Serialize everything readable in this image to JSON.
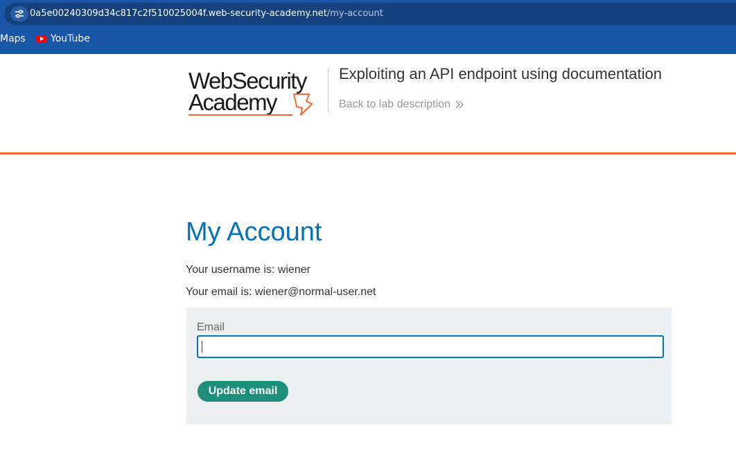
{
  "browser": {
    "url_host": "0a5e00240309d34c817c2f510025004f.web-security-academy.net",
    "url_path": "/my-account",
    "bookmarks": [
      {
        "label": "Maps"
      },
      {
        "label": "YouTube",
        "icon": "youtube-icon"
      }
    ]
  },
  "header": {
    "logo_line1": "WebSecurity",
    "logo_line2": "Academy",
    "lab_title": "Exploiting an API endpoint using documentation",
    "back_link": "Back to lab description",
    "accent_color": "#ff6633"
  },
  "main": {
    "title": "My Account",
    "username_line": "Your username is: wiener",
    "email_line": "Your email is: wiener@normal-user.net",
    "form": {
      "email_label": "Email",
      "email_value": "",
      "submit_label": "Update email"
    },
    "colors": {
      "title": "#0071bc",
      "button": "#1e8f7a",
      "panel": "#ebeff2"
    }
  }
}
